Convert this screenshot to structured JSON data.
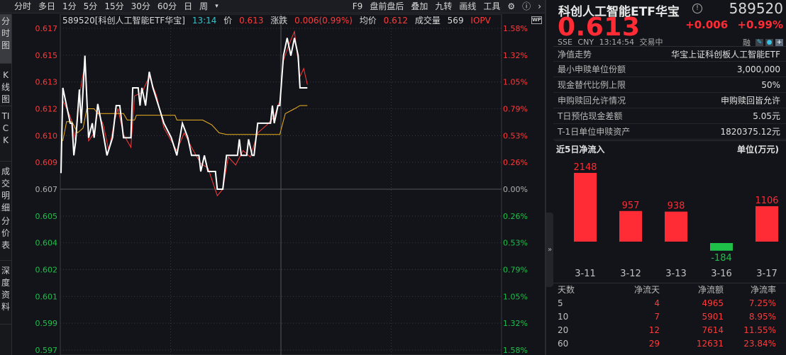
{
  "toolbar": {
    "items": [
      "分时",
      "多日",
      "1分",
      "5分",
      "15分",
      "30分",
      "60分",
      "日",
      "周",
      "▾"
    ],
    "right": [
      "F9",
      "盘前盘后",
      "叠加",
      "九转",
      "画线",
      "工具"
    ]
  },
  "left_tabs": [
    {
      "label": "分时图",
      "active": true
    },
    {
      "label": "K线图"
    },
    {
      "label": "TICK"
    },
    {
      "label": "成交明细"
    },
    {
      "label": "分价表"
    },
    {
      "label": "深度资料"
    }
  ],
  "info": {
    "name": "589520[科创人工智能ETF华宝]",
    "time": "13:14",
    "price_label": "价",
    "price": "0.613",
    "change_label": "涨跌",
    "change": "0.006(0.99%)",
    "avg_label": "均价",
    "avg": "0.612",
    "volume_label": "成交量",
    "volume": "569",
    "iopv_label": "IOPV",
    "wp": "WP"
  },
  "chart_data": {
    "type": "line",
    "prev_close": 0.607,
    "ylim": [
      0.5965,
      0.6175
    ],
    "y_ticks_left": [
      "0.617",
      "0.615",
      "0.613",
      "0.612",
      "0.610",
      "0.609",
      "0.607",
      "0.605",
      "0.604",
      "0.602",
      "0.601",
      "0.599",
      "0.597"
    ],
    "y_ticks_right": [
      "1.58%",
      "1.32%",
      "1.05%",
      "0.79%",
      "0.53%",
      "0.26%",
      "0.00%",
      "0.26%",
      "0.53%",
      "0.79%",
      "1.05%",
      "1.32%",
      "1.58%"
    ],
    "x_minutes_total": 240,
    "series": [
      {
        "name": "价格",
        "color": "#ffffff",
        "points": [
          [
            0,
            0.608
          ],
          [
            1,
            0.6133
          ],
          [
            3,
            0.6122
          ],
          [
            5,
            0.6111
          ],
          [
            6,
            0.6111
          ],
          [
            7,
            0.6091
          ],
          [
            8,
            0.61
          ],
          [
            10,
            0.6132
          ],
          [
            11,
            0.6111
          ],
          [
            13,
            0.6153
          ],
          [
            15,
            0.6102
          ],
          [
            17,
            0.6111
          ],
          [
            18,
            0.6102
          ],
          [
            20,
            0.6123
          ],
          [
            22,
            0.6111
          ],
          [
            25,
            0.6091
          ],
          [
            28,
            0.6102
          ],
          [
            30,
            0.6122
          ],
          [
            32,
            0.6122
          ],
          [
            34,
            0.6102
          ],
          [
            38,
            0.6102
          ],
          [
            39,
            0.6133
          ],
          [
            42,
            0.6133
          ],
          [
            43,
            0.6122
          ],
          [
            44,
            0.6133
          ],
          [
            46,
            0.6122
          ],
          [
            48,
            0.6143
          ],
          [
            50,
            0.6133
          ],
          [
            53,
            0.6122
          ],
          [
            56,
            0.6111
          ],
          [
            60,
            0.6102
          ],
          [
            63,
            0.6091
          ],
          [
            66,
            0.6111
          ],
          [
            69,
            0.6102
          ],
          [
            71,
            0.6091
          ],
          [
            75,
            0.6091
          ],
          [
            76,
            0.6081
          ],
          [
            78,
            0.6091
          ],
          [
            80,
            0.6081
          ],
          [
            84,
            0.6081
          ],
          [
            85,
            0.607
          ],
          [
            88,
            0.607
          ],
          [
            90,
            0.6091
          ],
          [
            96,
            0.6091
          ],
          [
            97,
            0.6101
          ],
          [
            98,
            0.6091
          ],
          [
            101,
            0.6091
          ],
          [
            102,
            0.6101
          ],
          [
            104,
            0.6091
          ],
          [
            105,
            0.6091
          ],
          [
            107,
            0.6111
          ],
          [
            114,
            0.6111
          ],
          [
            115,
            0.6122
          ],
          [
            116,
            0.6111
          ],
          [
            118,
            0.6122
          ],
          [
            119,
            0.6122
          ],
          [
            121,
            0.6153
          ],
          [
            123,
            0.6164
          ],
          [
            125,
            0.6153
          ],
          [
            127,
            0.6164
          ],
          [
            129,
            0.6153
          ],
          [
            130,
            0.6133
          ],
          [
            134,
            0.6133
          ]
        ]
      },
      {
        "name": "均价",
        "color": "#f0b020",
        "points": [
          [
            1,
            0.61
          ],
          [
            3,
            0.6112
          ],
          [
            6,
            0.6112
          ],
          [
            9,
            0.6105
          ],
          [
            12,
            0.6108
          ],
          [
            14,
            0.612
          ],
          [
            18,
            0.612
          ],
          [
            20,
            0.6117
          ],
          [
            34,
            0.6117
          ],
          [
            36,
            0.6113
          ],
          [
            40,
            0.6113
          ],
          [
            41,
            0.6116
          ],
          [
            62,
            0.6116
          ],
          [
            63,
            0.6113
          ],
          [
            77,
            0.6113
          ],
          [
            82,
            0.611
          ],
          [
            86,
            0.6105
          ],
          [
            90,
            0.6104
          ],
          [
            119,
            0.6104
          ],
          [
            122,
            0.6117
          ],
          [
            127,
            0.612
          ],
          [
            130,
            0.6122
          ],
          [
            134,
            0.6122
          ]
        ]
      },
      {
        "name": "IOPV",
        "color": "#ff3a3a",
        "points": [
          [
            1,
            0.6125
          ],
          [
            4,
            0.6118
          ],
          [
            6,
            0.6112
          ],
          [
            8,
            0.6098
          ],
          [
            10,
            0.6128
          ],
          [
            13,
            0.6148
          ],
          [
            15,
            0.61
          ],
          [
            18,
            0.6105
          ],
          [
            20,
            0.6118
          ],
          [
            23,
            0.611
          ],
          [
            26,
            0.6094
          ],
          [
            29,
            0.6112
          ],
          [
            31,
            0.612
          ],
          [
            34,
            0.6104
          ],
          [
            38,
            0.6096
          ],
          [
            40,
            0.6128
          ],
          [
            44,
            0.613
          ],
          [
            48,
            0.614
          ],
          [
            52,
            0.6128
          ],
          [
            56,
            0.6108
          ],
          [
            60,
            0.61
          ],
          [
            63,
            0.6094
          ],
          [
            67,
            0.6105
          ],
          [
            71,
            0.6096
          ],
          [
            76,
            0.6086
          ],
          [
            80,
            0.6083
          ],
          [
            85,
            0.6066
          ],
          [
            88,
            0.607
          ],
          [
            91,
            0.609
          ],
          [
            95,
            0.6085
          ],
          [
            99,
            0.6094
          ],
          [
            103,
            0.609
          ],
          [
            107,
            0.6105
          ],
          [
            112,
            0.611
          ],
          [
            116,
            0.6115
          ],
          [
            119,
            0.6125
          ],
          [
            121,
            0.615
          ],
          [
            124,
            0.616
          ],
          [
            127,
            0.6168
          ],
          [
            130,
            0.614
          ],
          [
            132,
            0.6145
          ],
          [
            134,
            0.6135
          ]
        ]
      }
    ]
  },
  "quote": {
    "title": "科创人工智能ETF华宝",
    "code": "589520",
    "price": "0.613",
    "change": "+0.006",
    "change_pct": "+0.99%",
    "exchange": "SSE",
    "currency": "CNY",
    "time": "13:14:54",
    "status": "交易中",
    "rong": "融"
  },
  "details": [
    {
      "k": "净值走势",
      "v": "华宝上证科创板人工智能ETF"
    },
    {
      "k": "最小申赎单位份额",
      "v": "3,000,000"
    },
    {
      "k": "现金替代比例上限",
      "v": "50%"
    },
    {
      "k": "申购赎回允许情况",
      "v": "申购赎回皆允许"
    },
    {
      "k": "T日预估现金差额",
      "v": "5.05元"
    },
    {
      "k": "T-1日单位申赎资产",
      "v": "1820375.12元"
    }
  ],
  "flow": {
    "title": "近5日净流入",
    "unit": "单位(万元)",
    "dates": [
      "3-11",
      "3-12",
      "3-13",
      "3-16",
      "3-17"
    ],
    "values": [
      2148,
      957,
      938,
      -184,
      1106
    ],
    "labels": [
      "2148",
      "957",
      "938",
      "-184",
      "1106"
    ],
    "up_color": "#ff2b35",
    "down_color": "#1fc04a"
  },
  "flow_table": {
    "headers": [
      "天数",
      "净流天",
      "净流额",
      "净流率"
    ],
    "rows": [
      [
        "5",
        "4",
        "4965",
        "7.25%"
      ],
      [
        "10",
        "7",
        "5901",
        "8.95%"
      ],
      [
        "20",
        "12",
        "7614",
        "11.55%"
      ],
      [
        "60",
        "29",
        "12631",
        "23.84%"
      ]
    ]
  }
}
